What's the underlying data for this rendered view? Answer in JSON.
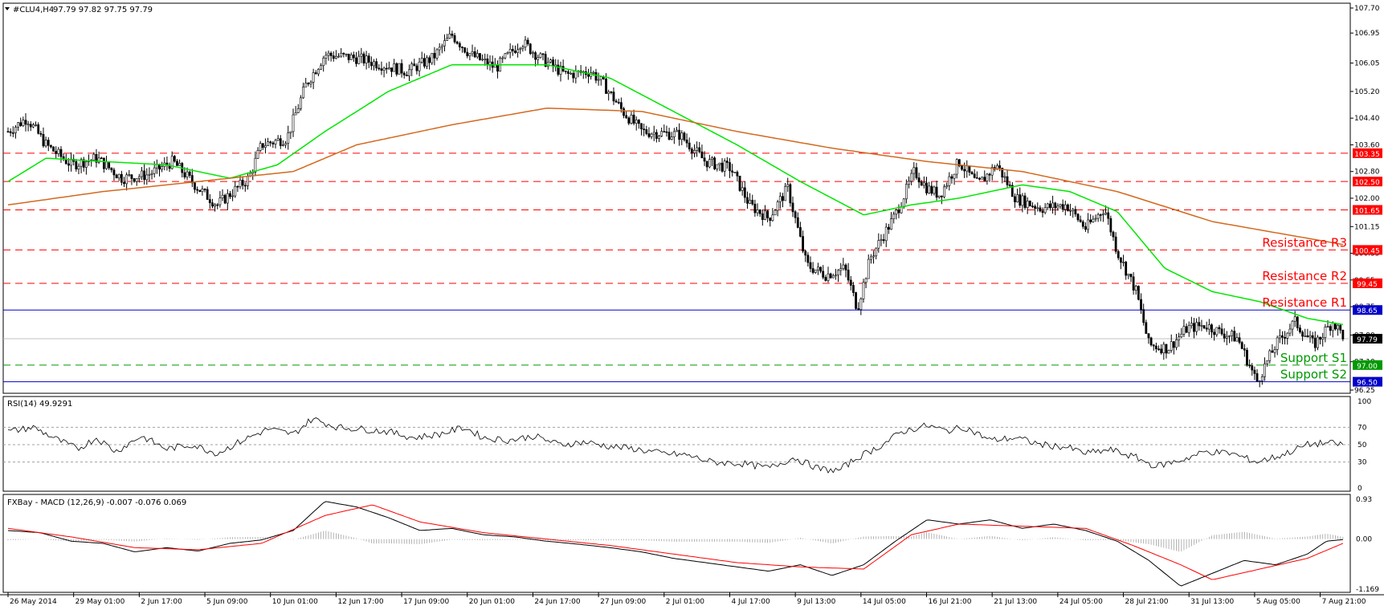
{
  "header": {
    "title": "#CLU4,H4",
    "ohlc": "97.79 97.82 97.75 97.79",
    "menu_icon": "triangle-down-icon"
  },
  "colors": {
    "background": "#ffffff",
    "frame": "#000000",
    "candle_up": "#ffffff",
    "candle_down": "#000000",
    "ma_fast": "#00e600",
    "ma_slow": "#d2691e",
    "resistance": "#ff0000",
    "support": "#009900",
    "blue_level": "#0000c8",
    "rsi_line": "#000000",
    "macd_line": "#000000",
    "signal_line": "#ff0000",
    "histogram": "#a0a0a0",
    "red_badge": "#ff0000",
    "green_badge": "#009900",
    "blue_badge": "#0000c8",
    "price_badge": "#000000"
  },
  "chart_data": [
    {
      "type": "candlestick",
      "title": "#CLU4,H4",
      "ylim": [
        96.25,
        107.7
      ],
      "price_ticks": [
        "107.70",
        "106.95",
        "106.05",
        "105.20",
        "104.40",
        "103.60",
        "102.80",
        "102.00",
        "101.15",
        "100.35",
        "99.55",
        "98.75",
        "97.90",
        "97.10",
        "96.25"
      ],
      "levels": [
        {
          "name": "Resistance R3",
          "value": 100.45,
          "badge": "100.45",
          "style": "red-dashed"
        },
        {
          "name": "Resistance R2",
          "value": 99.45,
          "badge": "99.45",
          "style": "red-dashed"
        },
        {
          "name": "Resistance R1",
          "value": 98.65,
          "badge": "98.65",
          "style": "blue-solid"
        },
        {
          "name": "",
          "value": 103.35,
          "badge": "103.35",
          "style": "red-dashed"
        },
        {
          "name": "",
          "value": 102.5,
          "badge": "102.50",
          "style": "red-dashed"
        },
        {
          "name": "",
          "value": 101.65,
          "badge": "101.65",
          "style": "red-dashed"
        },
        {
          "name": "Support S1",
          "value": 97.0,
          "badge": "97.00",
          "style": "green-dashed"
        },
        {
          "name": "Support S2",
          "value": 96.5,
          "badge": "96.50",
          "style": "blue-solid"
        }
      ],
      "current_price": {
        "value": 97.79,
        "badge": "97.79"
      },
      "price_path": [
        [
          0,
          104.0
        ],
        [
          6,
          104.4
        ],
        [
          12,
          103.6
        ],
        [
          20,
          103.0
        ],
        [
          28,
          103.2
        ],
        [
          36,
          102.6
        ],
        [
          44,
          102.7
        ],
        [
          52,
          103.1
        ],
        [
          60,
          102.3
        ],
        [
          66,
          101.8
        ],
        [
          76,
          102.6
        ],
        [
          80,
          103.6
        ],
        [
          88,
          103.8
        ],
        [
          94,
          105.4
        ],
        [
          100,
          106.3
        ],
        [
          110,
          106.2
        ],
        [
          118,
          106.0
        ],
        [
          126,
          105.8
        ],
        [
          134,
          106.2
        ],
        [
          140,
          106.9
        ],
        [
          146,
          106.3
        ],
        [
          154,
          105.9
        ],
        [
          162,
          106.7
        ],
        [
          168,
          106.2
        ],
        [
          176,
          105.7
        ],
        [
          184,
          105.8
        ],
        [
          188,
          105.4
        ],
        [
          194,
          104.6
        ],
        [
          200,
          104.0
        ],
        [
          212,
          103.9
        ],
        [
          220,
          103.1
        ],
        [
          228,
          102.9
        ],
        [
          234,
          101.8
        ],
        [
          240,
          101.4
        ],
        [
          246,
          102.3
        ],
        [
          252,
          100.0
        ],
        [
          258,
          99.7
        ],
        [
          264,
          99.9
        ],
        [
          268,
          98.7
        ],
        [
          272,
          100.2
        ],
        [
          280,
          101.5
        ],
        [
          286,
          102.8
        ],
        [
          290,
          102.3
        ],
        [
          294,
          102.1
        ],
        [
          300,
          103.1
        ],
        [
          306,
          102.4
        ],
        [
          312,
          103.0
        ],
        [
          318,
          102.0
        ],
        [
          326,
          101.7
        ],
        [
          334,
          101.8
        ],
        [
          340,
          101.1
        ],
        [
          346,
          101.7
        ],
        [
          350,
          100.4
        ],
        [
          356,
          99.2
        ],
        [
          360,
          97.6
        ],
        [
          366,
          97.5
        ],
        [
          372,
          98.1
        ],
        [
          378,
          98.2
        ],
        [
          382,
          98.0
        ],
        [
          388,
          97.8
        ],
        [
          394,
          96.5
        ],
        [
          400,
          97.6
        ],
        [
          406,
          98.3
        ],
        [
          412,
          97.6
        ],
        [
          418,
          98.3
        ],
        [
          422,
          97.79
        ]
      ],
      "ma_fast_path": [
        [
          0,
          102.5
        ],
        [
          12,
          103.2
        ],
        [
          30,
          103.1
        ],
        [
          50,
          103.0
        ],
        [
          70,
          102.6
        ],
        [
          85,
          103.0
        ],
        [
          100,
          104.0
        ],
        [
          120,
          105.2
        ],
        [
          140,
          106.0
        ],
        [
          170,
          106.0
        ],
        [
          190,
          105.6
        ],
        [
          210,
          104.6
        ],
        [
          230,
          103.6
        ],
        [
          250,
          102.5
        ],
        [
          270,
          101.5
        ],
        [
          285,
          101.8
        ],
        [
          300,
          102.0
        ],
        [
          320,
          102.4
        ],
        [
          335,
          102.2
        ],
        [
          350,
          101.6
        ],
        [
          365,
          99.9
        ],
        [
          380,
          99.2
        ],
        [
          395,
          98.9
        ],
        [
          410,
          98.4
        ],
        [
          422,
          98.2
        ]
      ],
      "ma_slow_path": [
        [
          0,
          101.8
        ],
        [
          30,
          102.2
        ],
        [
          60,
          102.5
        ],
        [
          90,
          102.8
        ],
        [
          110,
          103.6
        ],
        [
          140,
          104.2
        ],
        [
          170,
          104.7
        ],
        [
          200,
          104.6
        ],
        [
          230,
          104.0
        ],
        [
          260,
          103.5
        ],
        [
          290,
          103.1
        ],
        [
          320,
          102.8
        ],
        [
          350,
          102.2
        ],
        [
          380,
          101.3
        ],
        [
          410,
          100.8
        ],
        [
          422,
          100.6
        ]
      ]
    },
    {
      "type": "line",
      "title": "RSI(14) 49.9291",
      "ylim": [
        0,
        100
      ],
      "ticks": [
        "100",
        "70",
        "50",
        "30",
        "0"
      ],
      "reference_lines": [
        70,
        50,
        30
      ],
      "series": [
        {
          "name": "RSI(14)",
          "points": [
            [
              0,
              65
            ],
            [
              8,
              70
            ],
            [
              16,
              55
            ],
            [
              22,
              45
            ],
            [
              28,
              58
            ],
            [
              34,
              42
            ],
            [
              42,
              60
            ],
            [
              50,
              45
            ],
            [
              58,
              50
            ],
            [
              66,
              40
            ],
            [
              74,
              55
            ],
            [
              82,
              68
            ],
            [
              90,
              62
            ],
            [
              96,
              80
            ],
            [
              104,
              70
            ],
            [
              112,
              68
            ],
            [
              120,
              65
            ],
            [
              128,
              58
            ],
            [
              136,
              62
            ],
            [
              144,
              70
            ],
            [
              150,
              58
            ],
            [
              158,
              55
            ],
            [
              166,
              60
            ],
            [
              174,
              50
            ],
            [
              182,
              53
            ],
            [
              190,
              48
            ],
            [
              198,
              45
            ],
            [
              206,
              40
            ],
            [
              214,
              38
            ],
            [
              222,
              30
            ],
            [
              232,
              28
            ],
            [
              240,
              23
            ],
            [
              248,
              35
            ],
            [
              256,
              22
            ],
            [
              262,
              20
            ],
            [
              268,
              35
            ],
            [
              276,
              50
            ],
            [
              282,
              65
            ],
            [
              290,
              72
            ],
            [
              296,
              66
            ],
            [
              302,
              70
            ],
            [
              310,
              55
            ],
            [
              318,
              58
            ],
            [
              326,
              50
            ],
            [
              334,
              47
            ],
            [
              340,
              40
            ],
            [
              348,
              44
            ],
            [
              356,
              35
            ],
            [
              362,
              25
            ],
            [
              370,
              32
            ],
            [
              378,
              42
            ],
            [
              386,
              40
            ],
            [
              394,
              30
            ],
            [
              402,
              38
            ],
            [
              410,
              50
            ],
            [
              416,
              52
            ],
            [
              422,
              49.9
            ]
          ]
        }
      ]
    },
    {
      "type": "line",
      "title": "FXBay - MACD (12,26,9) -0.007 -0.076 0.069",
      "ylim": [
        -1.169,
        0.93
      ],
      "ticks": [
        "0.93",
        "0.00",
        "-1.169"
      ],
      "series": [
        {
          "name": "MACD",
          "points": [
            [
              0,
              0.2
            ],
            [
              10,
              0.15
            ],
            [
              20,
              -0.05
            ],
            [
              30,
              -0.1
            ],
            [
              40,
              -0.3
            ],
            [
              50,
              -0.2
            ],
            [
              60,
              -0.28
            ],
            [
              70,
              -0.1
            ],
            [
              80,
              -0.02
            ],
            [
              90,
              0.2
            ],
            [
              100,
              0.88
            ],
            [
              110,
              0.75
            ],
            [
              120,
              0.5
            ],
            [
              130,
              0.2
            ],
            [
              140,
              0.25
            ],
            [
              150,
              0.1
            ],
            [
              160,
              0.05
            ],
            [
              170,
              -0.05
            ],
            [
              180,
              -0.12
            ],
            [
              190,
              -0.2
            ],
            [
              200,
              -0.3
            ],
            [
              210,
              -0.45
            ],
            [
              220,
              -0.55
            ],
            [
              230,
              -0.65
            ],
            [
              240,
              -0.75
            ],
            [
              250,
              -0.6
            ],
            [
              260,
              -0.85
            ],
            [
              270,
              -0.6
            ],
            [
              280,
              -0.05
            ],
            [
              290,
              0.45
            ],
            [
              300,
              0.35
            ],
            [
              310,
              0.45
            ],
            [
              320,
              0.25
            ],
            [
              330,
              0.35
            ],
            [
              340,
              0.2
            ],
            [
              350,
              -0.05
            ],
            [
              360,
              -0.5
            ],
            [
              370,
              -1.1
            ],
            [
              380,
              -0.8
            ],
            [
              390,
              -0.5
            ],
            [
              400,
              -0.6
            ],
            [
              410,
              -0.35
            ],
            [
              416,
              -0.05
            ],
            [
              422,
              -0.007
            ]
          ]
        },
        {
          "name": "Signal",
          "points": [
            [
              0,
              0.25
            ],
            [
              20,
              0.05
            ],
            [
              40,
              -0.2
            ],
            [
              60,
              -0.25
            ],
            [
              80,
              -0.1
            ],
            [
              100,
              0.55
            ],
            [
              115,
              0.8
            ],
            [
              130,
              0.4
            ],
            [
              150,
              0.15
            ],
            [
              170,
              0.0
            ],
            [
              190,
              -0.15
            ],
            [
              210,
              -0.35
            ],
            [
              230,
              -0.55
            ],
            [
              250,
              -0.65
            ],
            [
              270,
              -0.7
            ],
            [
              285,
              0.1
            ],
            [
              300,
              0.35
            ],
            [
              320,
              0.3
            ],
            [
              340,
              0.25
            ],
            [
              355,
              -0.15
            ],
            [
              370,
              -0.6
            ],
            [
              380,
              -0.95
            ],
            [
              395,
              -0.7
            ],
            [
              410,
              -0.45
            ],
            [
              422,
              -0.076
            ]
          ]
        }
      ],
      "histogram_last": 0.069
    }
  ],
  "time_axis": {
    "labels": [
      {
        "i": 0,
        "text": "26 May 2014"
      },
      {
        "i": 26,
        "text": "29 May 01:00"
      },
      {
        "i": 52,
        "text": "2 Jun 17:00"
      },
      {
        "i": 78,
        "text": "5 Jun 09:00"
      },
      {
        "i": 104,
        "text": "10 Jun 01:00"
      },
      {
        "i": 130,
        "text": "12 Jun 17:00"
      },
      {
        "i": 156,
        "text": "17 Jun 09:00"
      },
      {
        "i": 182,
        "text": "20 Jun 01:00"
      },
      {
        "i": 208,
        "text": "24 Jun 17:00"
      },
      {
        "i": 234,
        "text": "27 Jun 09:00"
      },
      {
        "i": 260,
        "text": "2 Jul 01:00"
      },
      {
        "i": 286,
        "text": "4 Jul 17:00"
      },
      {
        "i": 312,
        "text": "9 Jul 13:00"
      },
      {
        "i": 338,
        "text": "14 Jul 05:00"
      },
      {
        "i": 364,
        "text": "16 Jul 21:00"
      },
      {
        "i": 390,
        "text": "21 Jul 13:00"
      },
      {
        "i": 416,
        "text": "24 Jul 05:00"
      },
      {
        "i": 442,
        "text": "28 Jul 21:00"
      },
      {
        "i": 468,
        "text": "31 Jul 13:00"
      },
      {
        "i": 494,
        "text": "5 Aug 05:00"
      },
      {
        "i": 520,
        "text": "7 Aug 21:00"
      }
    ]
  }
}
